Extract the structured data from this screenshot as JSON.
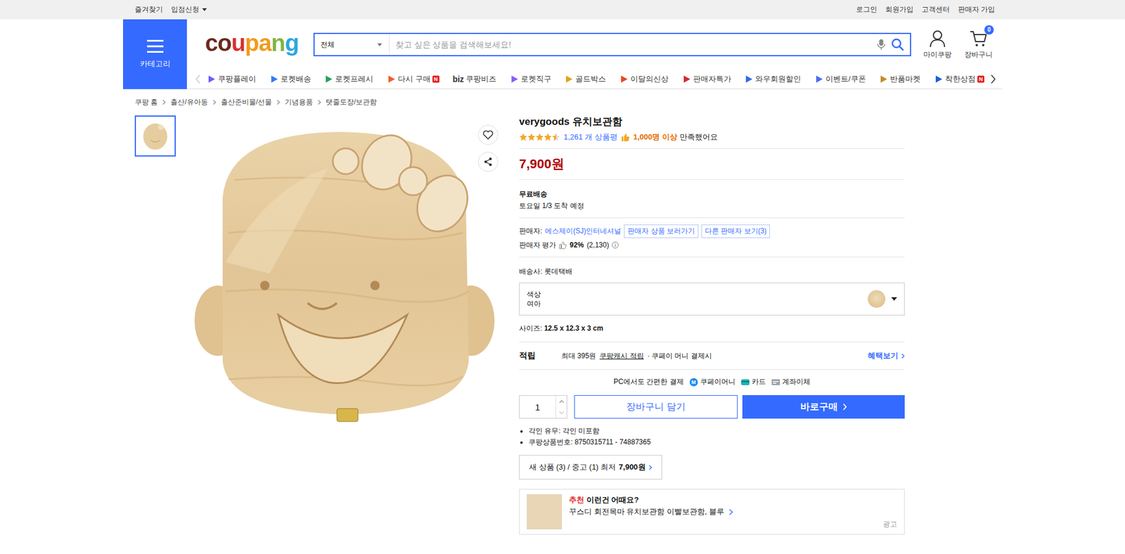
{
  "top_bar": {
    "left": [
      {
        "label": "즐겨찾기",
        "dropdown": false
      },
      {
        "label": "입점신청",
        "dropdown": true
      }
    ],
    "right": [
      "로그인",
      "회원가입",
      "고객센터",
      "판매자 가입"
    ]
  },
  "header": {
    "category_label": "카테고리",
    "logo": "coupang",
    "search": {
      "scope": "전체",
      "placeholder": "찾고 싶은 상품을 검색해보세요!"
    },
    "my_coupang": "마이쿠팡",
    "cart": {
      "label": "장바구니",
      "count": "0"
    }
  },
  "nav": {
    "prev_disabled": true,
    "next_disabled": false,
    "items": [
      {
        "label": "쿠팡플레이",
        "prefix": "",
        "badge": ""
      },
      {
        "label": "로켓배송",
        "prefix": "",
        "badge": ""
      },
      {
        "label": "로켓프레시",
        "prefix": "",
        "badge": ""
      },
      {
        "label": "다시 구매",
        "prefix": "",
        "badge": "N"
      },
      {
        "label": "쿠팡비즈",
        "prefix": "biz",
        "badge": ""
      },
      {
        "label": "로켓직구",
        "prefix": "",
        "badge": ""
      },
      {
        "label": "골드박스",
        "prefix": "",
        "badge": ""
      },
      {
        "label": "이달의신상",
        "prefix": "",
        "badge": ""
      },
      {
        "label": "판매자특가",
        "prefix": "",
        "badge": ""
      },
      {
        "label": "와우회원할인",
        "prefix": "",
        "badge": ""
      },
      {
        "label": "이벤트/쿠폰",
        "prefix": "",
        "badge": ""
      },
      {
        "label": "반품마켓",
        "prefix": "",
        "badge": ""
      },
      {
        "label": "착한상점",
        "prefix": "",
        "badge": "N"
      }
    ]
  },
  "breadcrumb": [
    "쿠팡 홈",
    "출산/유아동",
    "출산준비물/선물",
    "기념용품",
    "탯줄도장/보관함"
  ],
  "gallery": {
    "thumbnails": [
      {
        "selected": true
      }
    ],
    "liked": false
  },
  "product": {
    "title": "verygoods 유치보관함",
    "rating": {
      "stars": 4.5,
      "review_count": "1,261 개 상품평",
      "satisfied_count": "1,000명 이상",
      "satisfied_text": "만족했어요"
    },
    "price": "7,900원",
    "shipping": {
      "type": "무료배송",
      "arrival": "토요일 1/3 도착 예정"
    },
    "seller": {
      "label": "판매자:",
      "name": "에스제이(SJ)인터네셔널",
      "buttons": [
        "판매자 상품 보러가기",
        "다른 판매자 보기(3)"
      ],
      "rating_label": "판매자 평가",
      "rating": "92%",
      "rating_count": "(2,130)"
    },
    "carrier": {
      "label": "배송사:",
      "name": "롯데택배"
    },
    "option": {
      "label": "색상",
      "value": "여아"
    },
    "size": {
      "label": "사이즈:",
      "value": "12.5 x 12.3 x 3 cm"
    },
    "reward": {
      "label": "적립",
      "text": "최대 395원",
      "link": "쿠팡캐시 적립",
      "suffix": "· 쿠페이 머니 결제시",
      "more": "혜택보기"
    },
    "payment": {
      "label": "PC에서도 간편한 결제",
      "methods": [
        {
          "label": "쿠페이머니",
          "kind": "money",
          "mark": "M"
        },
        {
          "label": "카드",
          "kind": "card",
          "mark": ""
        },
        {
          "label": "계좌이체",
          "kind": "bank",
          "mark": ""
        }
      ]
    },
    "quantity": "1",
    "buttons": {
      "cart": "장바구니 담기",
      "buy": "바로구매"
    },
    "details": [
      "각인 유무: 각인 미포함",
      "쿠팡상품번호: 8750315711 - 74887365"
    ],
    "other_offers": {
      "text": "새 상품 (3) / 중고 (1) 최저",
      "price": "7,900원"
    },
    "recommendation": {
      "tag": "추천",
      "title": "이런건 어때요?",
      "item": "꾸스디 회전목마 유치보관함 이빨보관함, 블루",
      "label": "광고"
    }
  }
}
